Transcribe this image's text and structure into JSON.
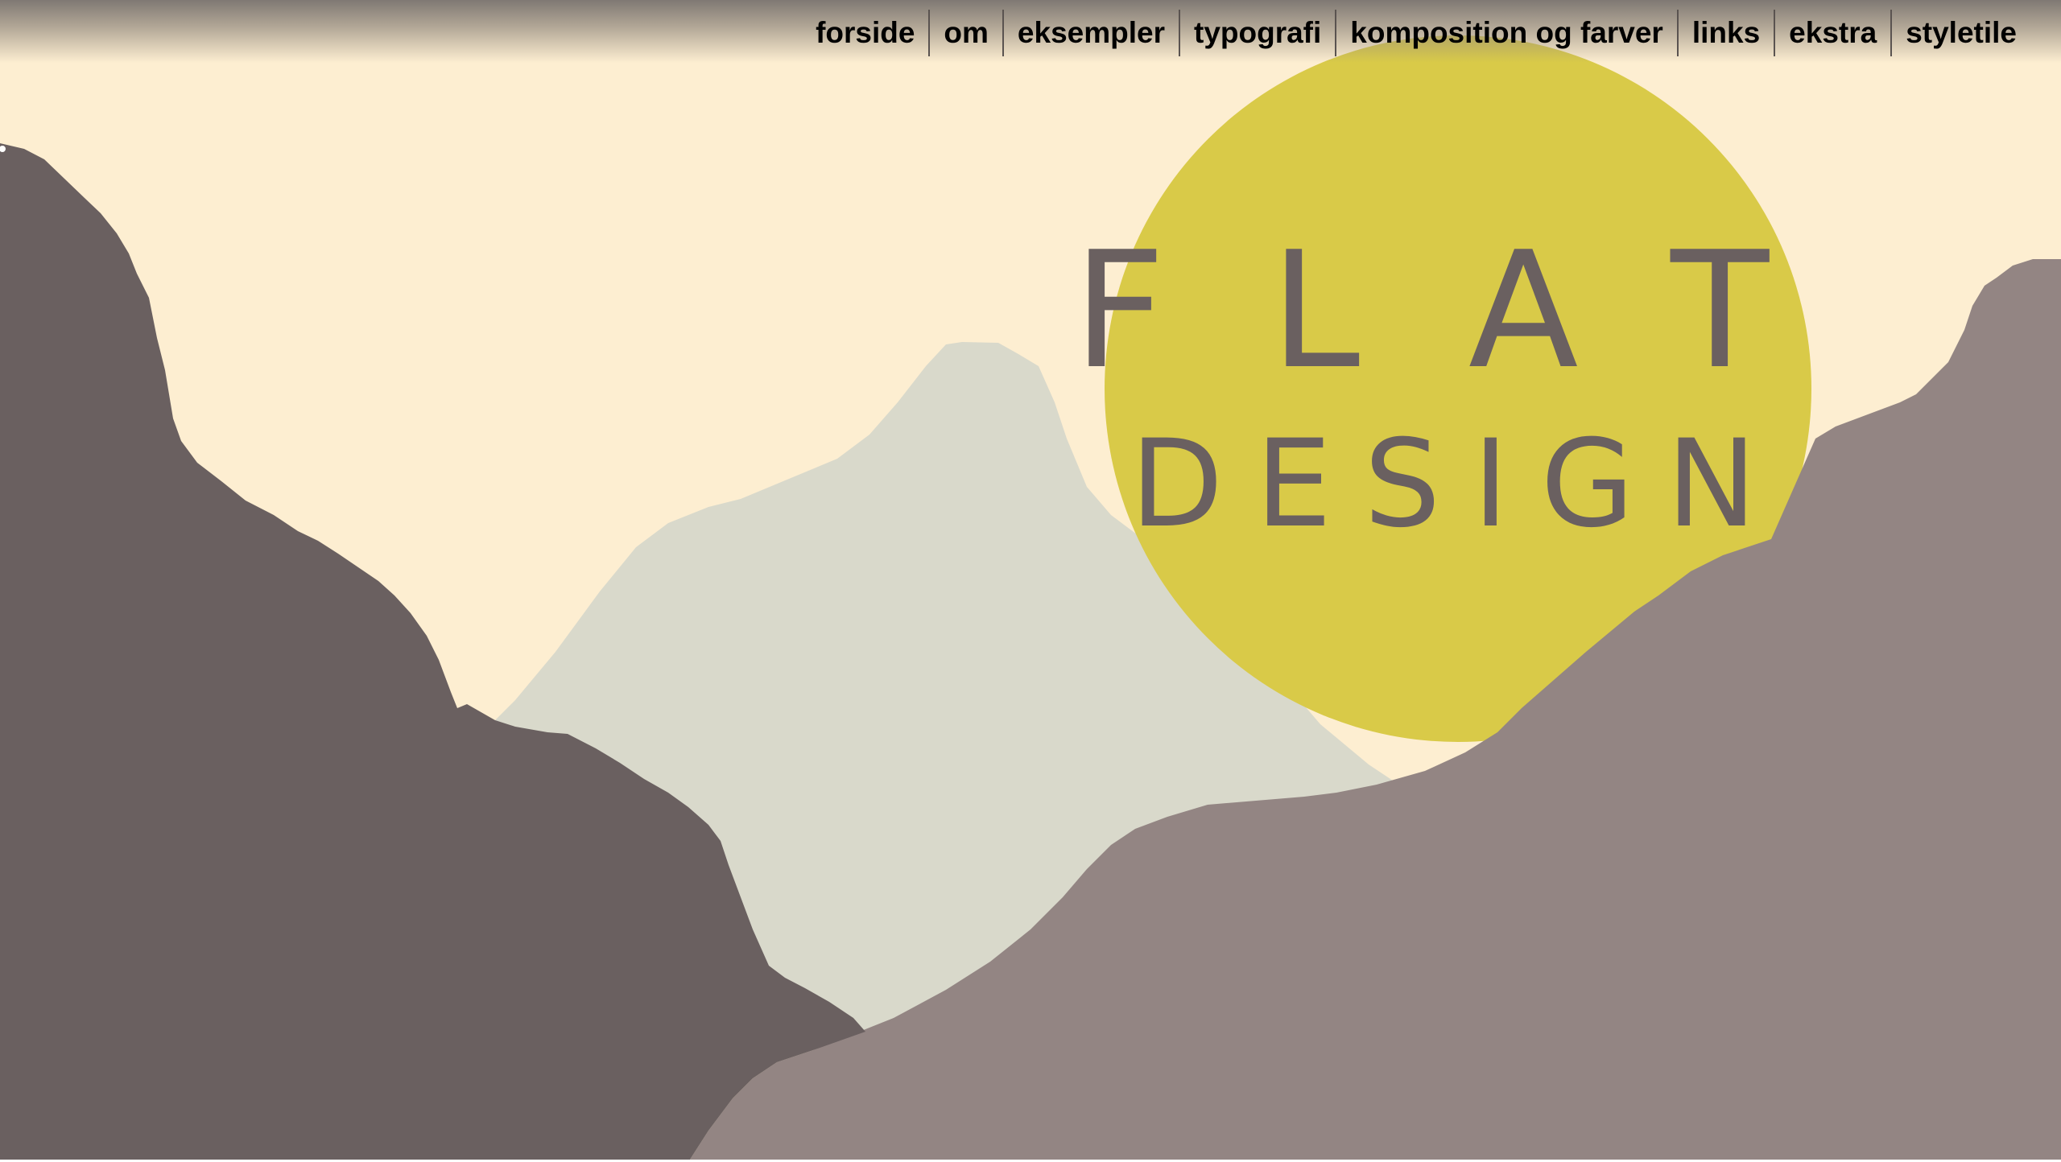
{
  "nav": {
    "items": [
      {
        "label": "forside"
      },
      {
        "label": "om"
      },
      {
        "label": "eksempler"
      },
      {
        "label": "typografi"
      },
      {
        "label": "komposition og farver"
      },
      {
        "label": "links"
      },
      {
        "label": "ekstra"
      },
      {
        "label": "styletile"
      }
    ]
  },
  "hero": {
    "title_line1": "FLAT",
    "title_line2": "DESIGN"
  },
  "colors": {
    "sky": "#fdeed1",
    "sun": "#d9ca48",
    "far_mountain": "#d9d9cb",
    "left_mountain": "#6a6060",
    "right_mountain": "#938583",
    "title_text": "#6a6060",
    "nav_text": "#000000"
  }
}
